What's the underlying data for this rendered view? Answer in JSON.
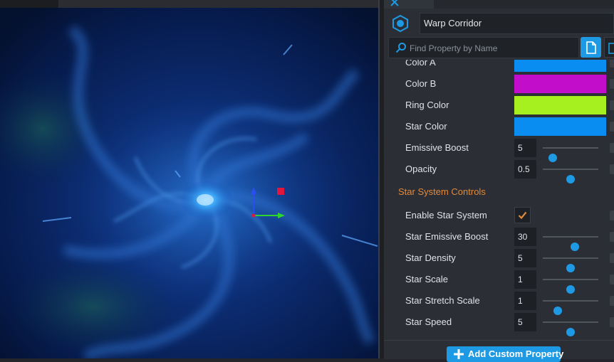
{
  "object": {
    "name": "Warp Corridor",
    "icon": "hexagon-object-icon"
  },
  "search": {
    "placeholder": "Find Property by Name"
  },
  "properties": {
    "color_a": {
      "label": "Color A",
      "color": "#0a8df0"
    },
    "color_b": {
      "label": "Color B",
      "color": "#c20ecb"
    },
    "ring_color": {
      "label": "Ring Color",
      "color": "#a6f01f"
    },
    "star_color": {
      "label": "Star Color",
      "color": "#0a8df0"
    },
    "emissive_boost": {
      "label": "Emissive Boost",
      "value": "5",
      "slider": 0.18
    },
    "opacity": {
      "label": "Opacity",
      "value": "0.5",
      "slider": 0.5
    },
    "section_star": {
      "label": "Star System Controls"
    },
    "enable_star_system": {
      "label": "Enable Star System",
      "checked": true
    },
    "star_emissive_boost": {
      "label": "Star Emissive Boost",
      "value": "30",
      "slider": 0.58
    },
    "star_density": {
      "label": "Star Density",
      "value": "5",
      "slider": 0.5
    },
    "star_scale": {
      "label": "Star Scale",
      "value": "1",
      "slider": 0.5
    },
    "star_stretch_scale": {
      "label": "Star Stretch Scale",
      "value": "1",
      "slider": 0.27
    },
    "star_speed": {
      "label": "Star Speed",
      "value": "5",
      "slider": 0.5
    }
  },
  "footer": {
    "add_label": "Add Custom Property"
  },
  "colors": {
    "accent": "#1e9ae5",
    "section": "#e08a3c"
  }
}
